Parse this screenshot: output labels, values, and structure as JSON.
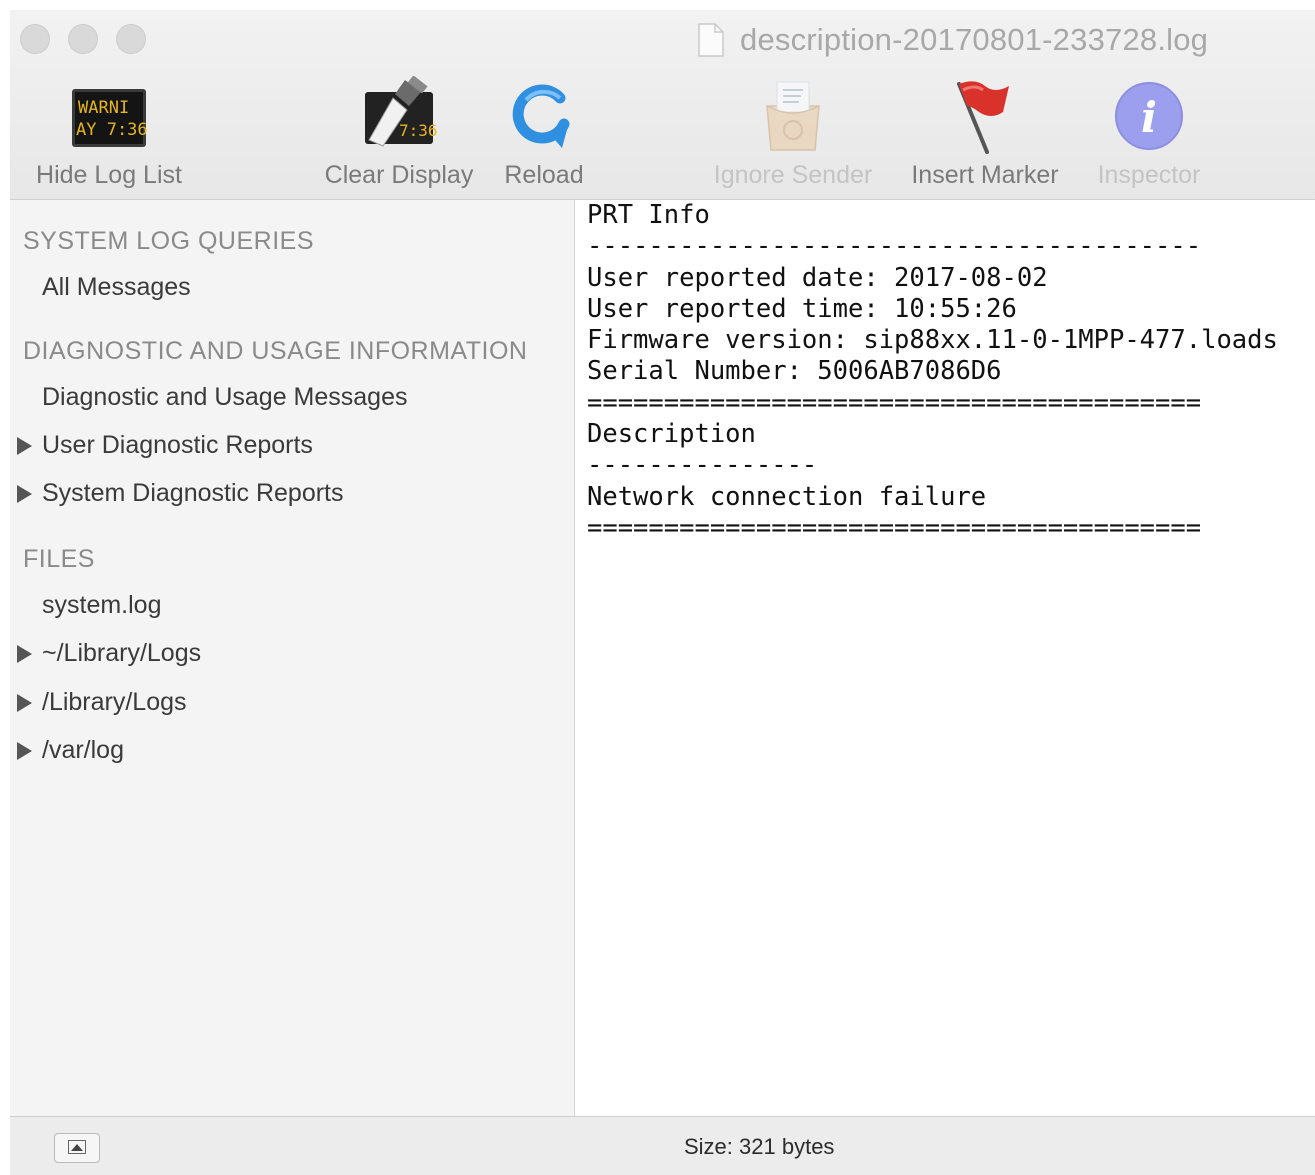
{
  "window": {
    "title": "description-20170801-233728.log"
  },
  "toolbar": {
    "hide_log_list": "Hide Log List",
    "clear_display": "Clear Display",
    "reload": "Reload",
    "ignore_sender": "Ignore Sender",
    "insert_marker": "Insert Marker",
    "inspector": "Inspector",
    "warning_icon_text_1": "WARNI",
    "warning_icon_text_2": "AY 7:36",
    "clear_icon_text": "7:36",
    "inspector_glyph": "i"
  },
  "sidebar": {
    "sections": [
      {
        "label": "SYSTEM LOG QUERIES",
        "items": [
          {
            "label": "All Messages",
            "expandable": false
          }
        ]
      },
      {
        "label": "DIAGNOSTIC AND USAGE INFORMATION",
        "items": [
          {
            "label": "Diagnostic and Usage Messages",
            "expandable": false
          },
          {
            "label": "User Diagnostic Reports",
            "expandable": true
          },
          {
            "label": "System Diagnostic Reports",
            "expandable": true
          }
        ]
      },
      {
        "label": "FILES",
        "items": [
          {
            "label": "system.log",
            "expandable": false
          },
          {
            "label": "~/Library/Logs",
            "expandable": true
          },
          {
            "label": "/Library/Logs",
            "expandable": true
          },
          {
            "label": "/var/log",
            "expandable": true
          }
        ]
      }
    ]
  },
  "log": {
    "lines": [
      "PRT Info",
      "----------------------------------------",
      "User reported date: 2017-08-02",
      "User reported time: 10:55:26",
      "Firmware version: sip88xx.11-0-1MPP-477.loads",
      "Serial Number: 5006AB7086D6",
      "========================================",
      "Description",
      "---------------",
      "Network connection failure",
      "========================================"
    ]
  },
  "status": {
    "size": "Size: 321 bytes"
  },
  "colors": {
    "flag": "#d8322a",
    "reload": "#2f8fe0",
    "inspector": "#9c9fee"
  }
}
